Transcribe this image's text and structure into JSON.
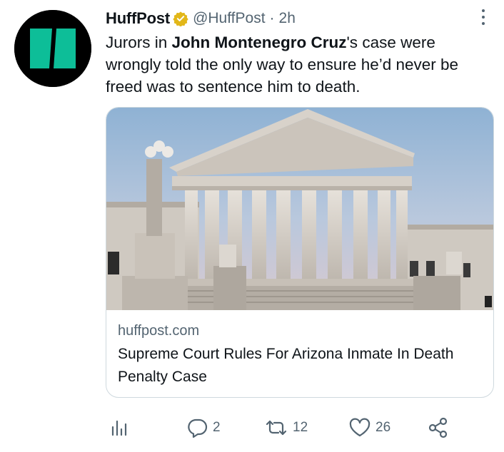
{
  "tweet": {
    "author_name": "HuffPost",
    "handle": "@HuffPost",
    "separator": "·",
    "time": "2h",
    "text_before": "Jurors in ",
    "text_bold": "John Montenegro Cruz",
    "text_after": "'s case were wrongly told the only way to ensure he’d never be freed was to sentence him to death."
  },
  "card": {
    "domain": "huffpost.com",
    "title": "Supreme Court Rules For Arizona Inmate In Death Penalty Case"
  },
  "actions": {
    "reply_count": "2",
    "retweet_count": "12",
    "like_count": "26"
  },
  "colors": {
    "brand": "#0dbe98",
    "verified": "#e2b719",
    "secondary_text": "#536471",
    "border": "#cfd9de"
  },
  "icons": [
    "huffpost-logo",
    "verified-badge-icon",
    "more-options-icon",
    "analytics-icon",
    "reply-icon",
    "retweet-icon",
    "like-icon",
    "share-icon"
  ]
}
